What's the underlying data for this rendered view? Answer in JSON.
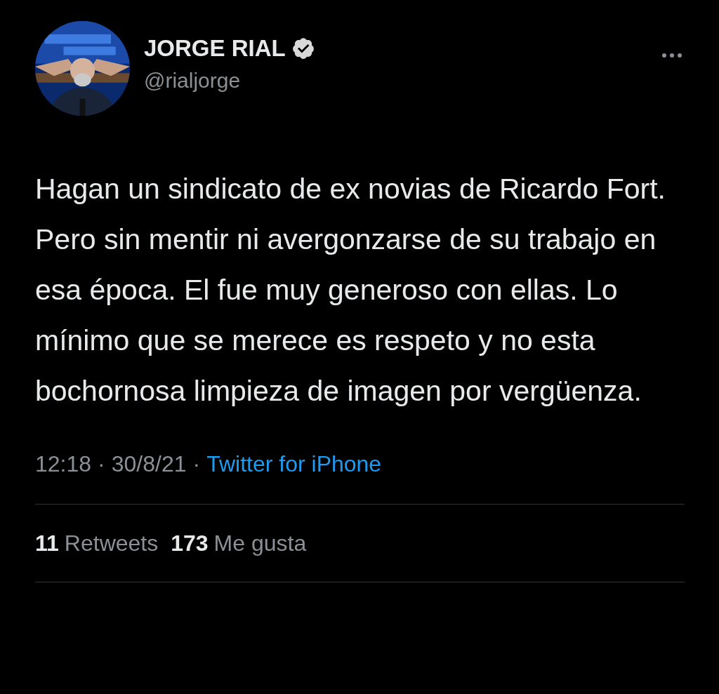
{
  "author": {
    "name": "JORGE RIAL",
    "verified": true,
    "handle": "@rialjorge"
  },
  "tweet": {
    "text": "Hagan un sindicato de ex novias de Ricardo Fort. Pero sin mentir ni avergonzarse de su trabajo en esa época. El fue muy generoso con ellas. Lo mínimo que se merece es respeto y no esta bochornosa limpieza de imagen por vergüenza."
  },
  "meta": {
    "time": "12:18",
    "separator_1": "·",
    "date": "30/8/21",
    "separator_2": "·",
    "source": "Twitter for iPhone"
  },
  "stats": [
    {
      "count": "11",
      "label": "Retweets"
    },
    {
      "count": "173",
      "label": "Me gusta"
    }
  ]
}
